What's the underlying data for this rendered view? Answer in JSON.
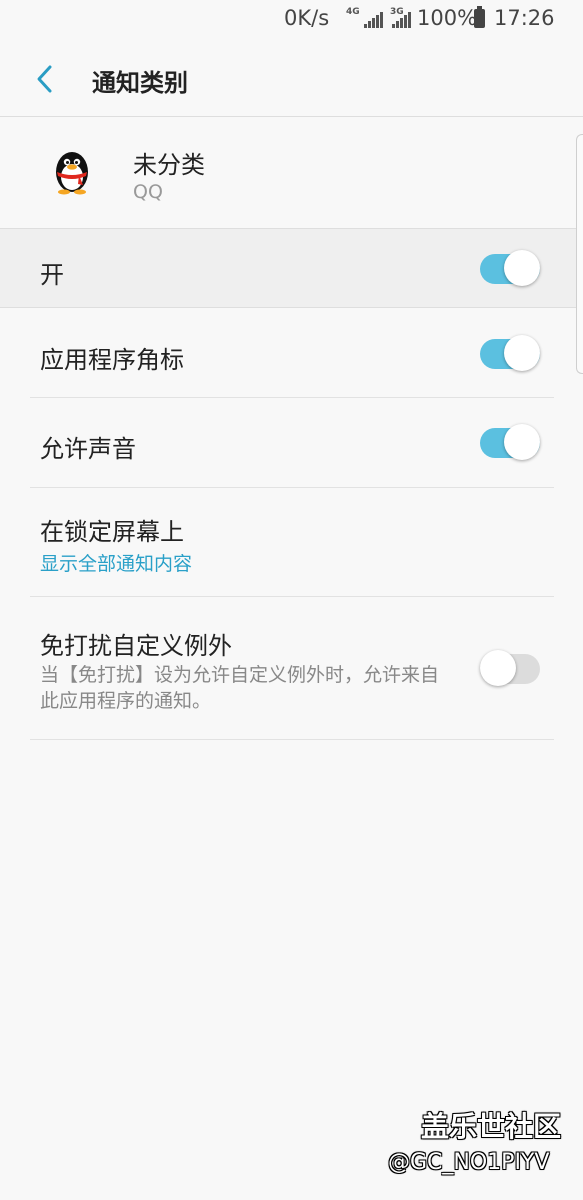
{
  "status_bar": {
    "speed": "0K/s",
    "network_type_1": "4G",
    "network_type_2": "3G",
    "battery_percent": "100%",
    "time": "17:26"
  },
  "header": {
    "title": "通知类别",
    "back_icon": "chevron-left-icon"
  },
  "app_info": {
    "name": "未分类",
    "subtitle": "QQ",
    "icon": "qq-penguin-icon"
  },
  "master_switch": {
    "label": "开",
    "enabled": true
  },
  "settings": [
    {
      "label": "应用程序角标",
      "enabled": true
    },
    {
      "label": "允许声音",
      "enabled": true
    },
    {
      "label": "在锁定屏幕上",
      "value": "显示全部通知内容"
    },
    {
      "label": "免打扰自定义例外",
      "description": "当【免打扰】设为允许自定义例外时，允许来自此应用程序的通知。",
      "enabled": false
    }
  ],
  "colors": {
    "accent": "#5bc0e0",
    "link": "#2aa0c8",
    "toggle_off": "#dcdcdc",
    "background": "#f8f8f8"
  },
  "watermark": {
    "line1": "盖乐世社区",
    "line2": "@GC_NO1PIYV"
  }
}
